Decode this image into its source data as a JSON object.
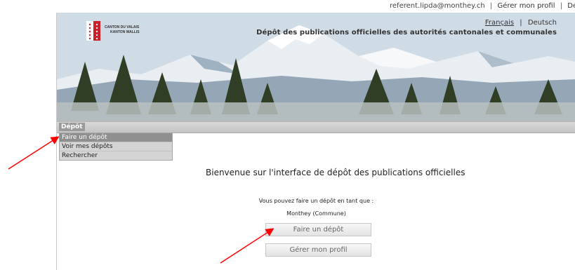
{
  "userbar": {
    "user": "referent.lipda@monthey.ch",
    "profile_link": "Gérer mon profil",
    "logout_link": "Déconnexion"
  },
  "banner": {
    "logo_line1": "CANTON DU VALAIS",
    "logo_line2": "KANTON WALLIS",
    "lang_fr": "Français",
    "lang_de": "Deutsch",
    "title": "Dépôt des publications officielles des autorités cantonales et communales"
  },
  "nav": {
    "depot": "Dépôt",
    "submenu": [
      "Faire un dépôt",
      "Voir mes dépôts",
      "Rechercher"
    ]
  },
  "main": {
    "welcome": "Bienvenue sur l'interface de dépôt des publications officielles",
    "intro": "Vous pouvez faire un dépôt en tant que :",
    "entity": "Monthey (Commune)",
    "btn_deposit": "Faire un dépôt",
    "btn_profile": "Gérer mon profil"
  },
  "colors": {
    "arrow": "#ff0000",
    "logo_red": "#cc1f2a"
  }
}
